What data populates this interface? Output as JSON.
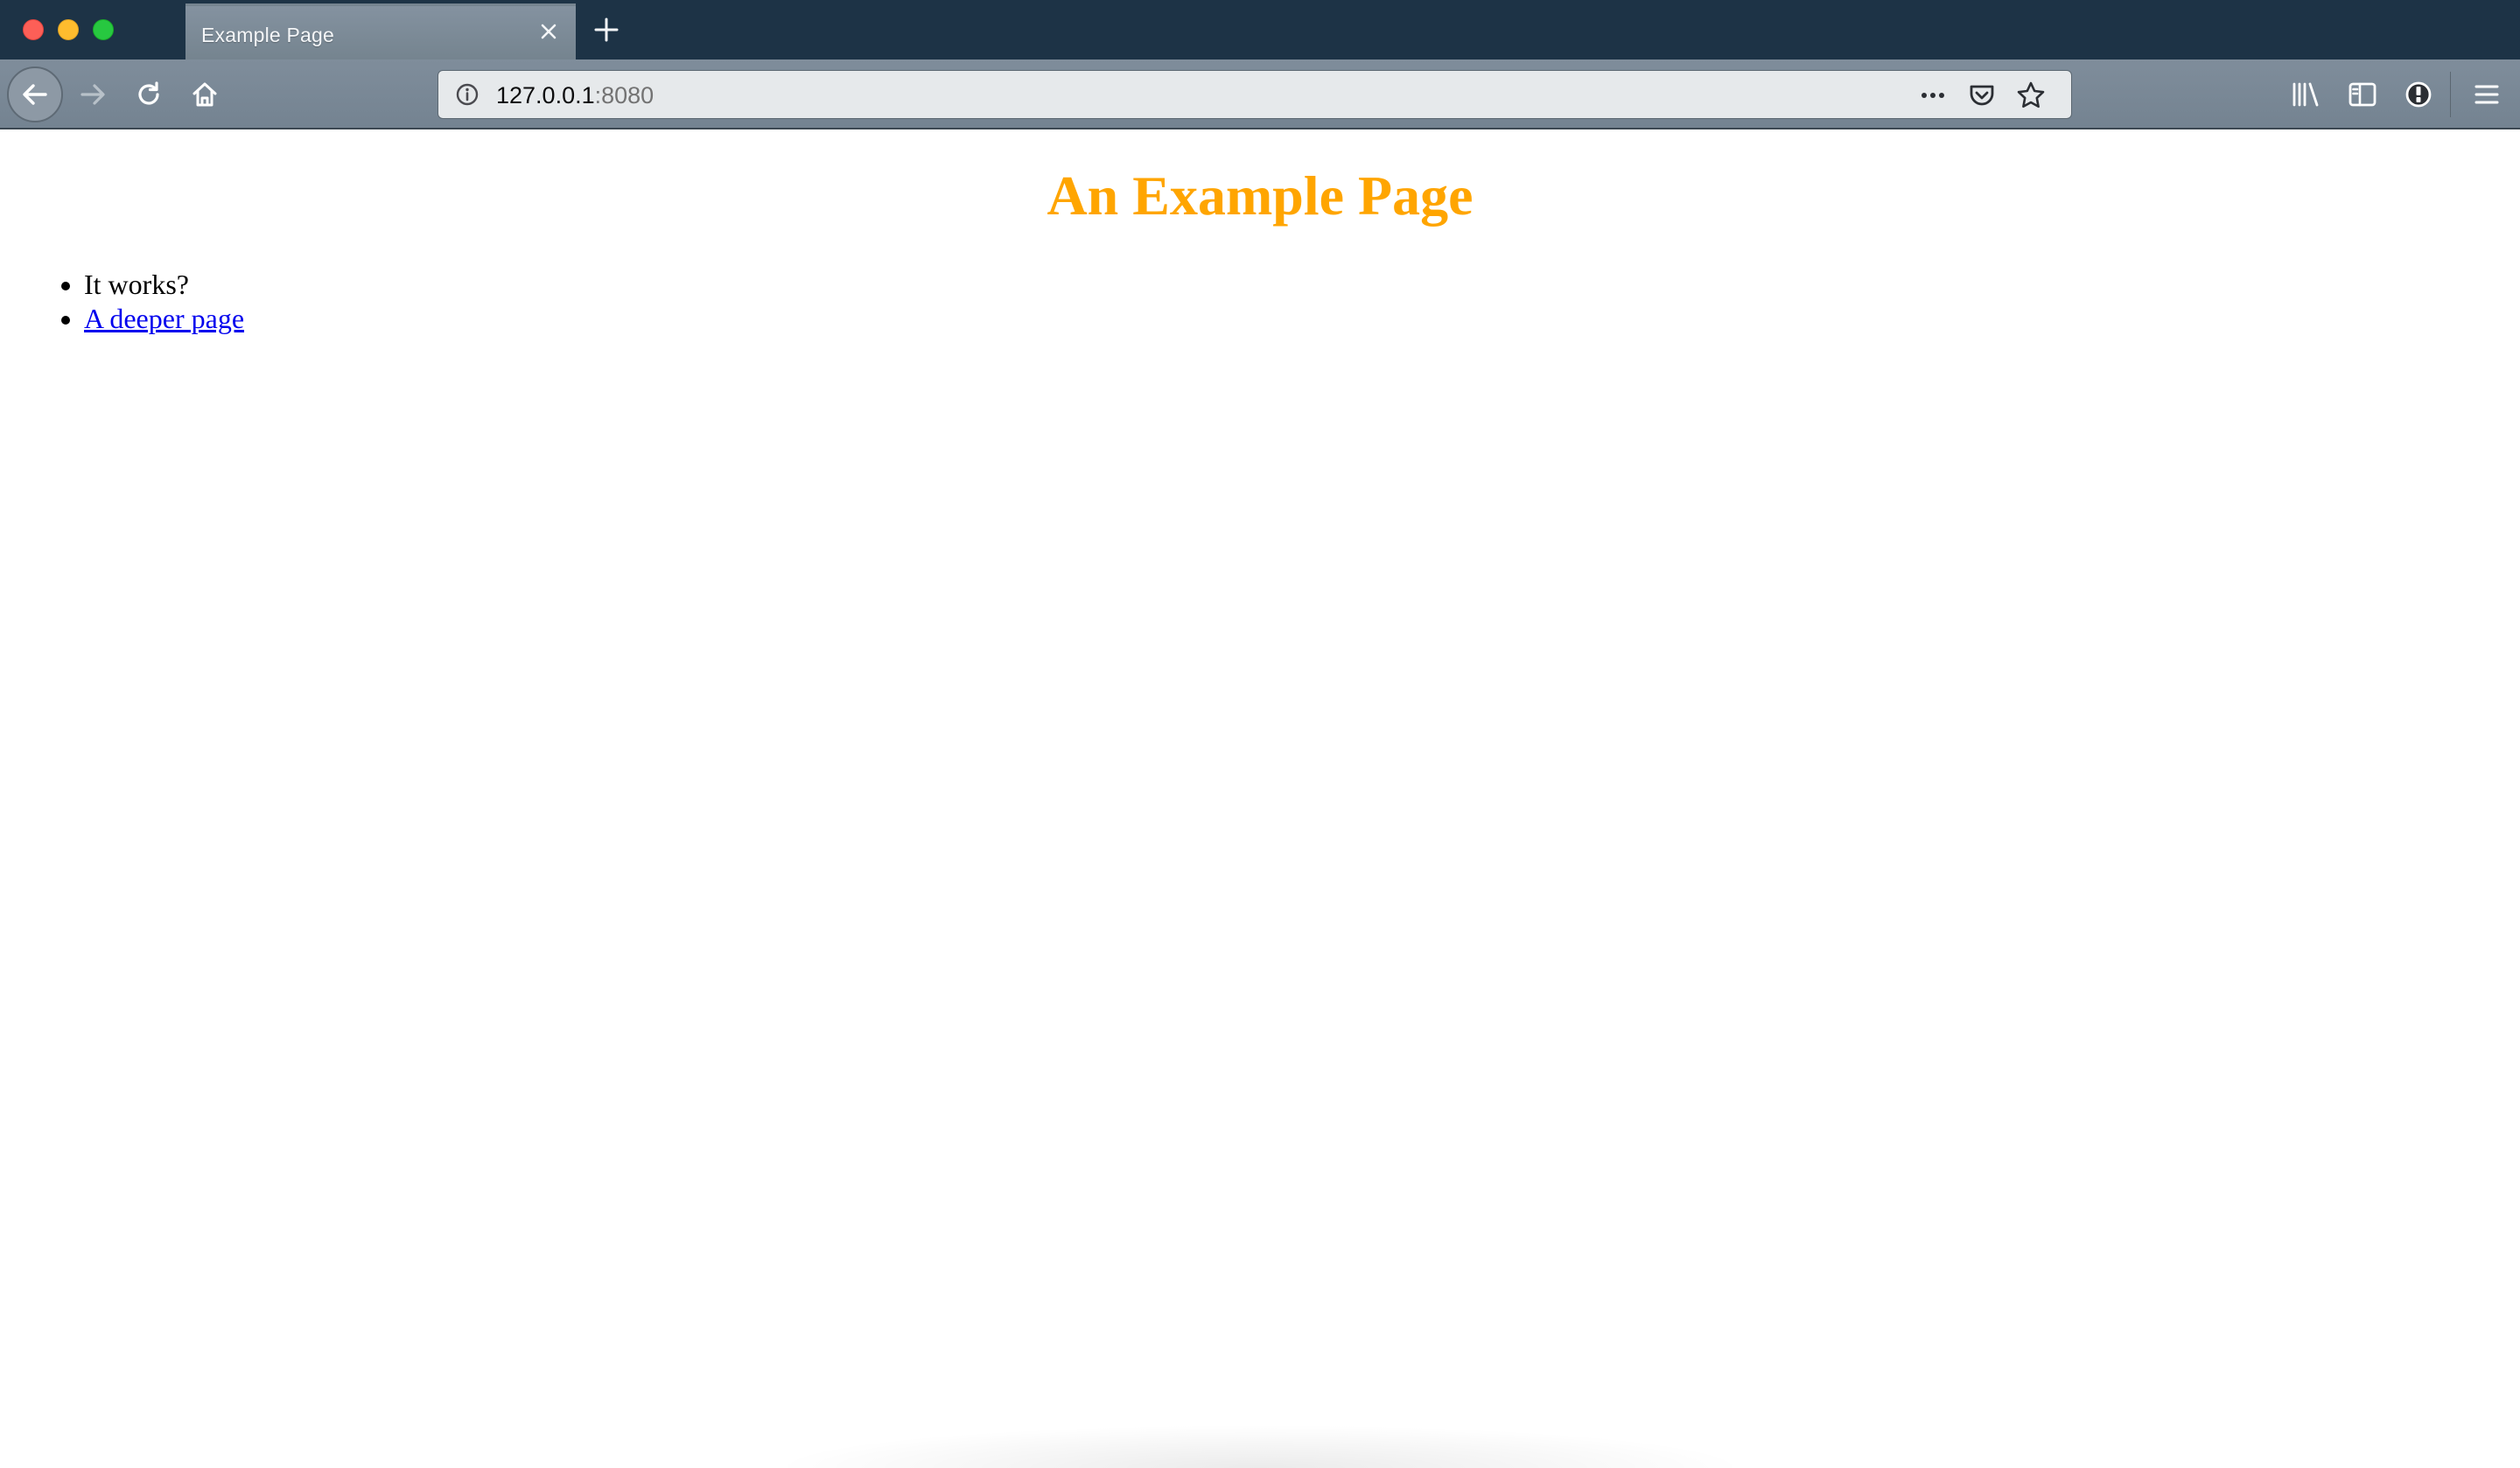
{
  "window": {
    "tab": {
      "title": "Example Page",
      "close_icon": "close-icon"
    },
    "new_tab_icon": "plus-icon"
  },
  "navbar": {
    "back_icon": "arrow-left-icon",
    "forward_icon": "arrow-right-icon",
    "reload_icon": "reload-icon",
    "home_icon": "home-icon",
    "url": {
      "host": "127.0.0.1",
      "port": ":8080",
      "info_icon": "info-icon"
    },
    "page_actions": [
      "more-icon",
      "pocket-icon",
      "star-icon"
    ],
    "toolbar": [
      "library-icon",
      "sidebar-icon",
      "extension-icon",
      "hamburger-menu-icon"
    ]
  },
  "page": {
    "heading": "An Example Page",
    "items": [
      {
        "text": "It works?"
      },
      {
        "text": "A deeper page",
        "is_link": true
      }
    ],
    "colors": {
      "heading": "#ffa500",
      "link": "#0000ee"
    }
  }
}
